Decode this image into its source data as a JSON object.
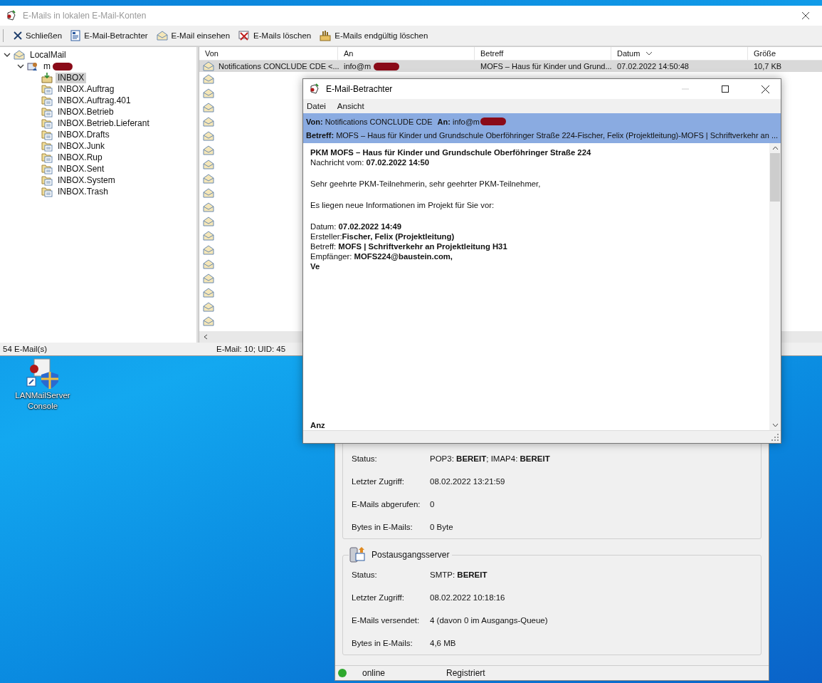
{
  "main_window": {
    "title": "E-Mails in lokalen E-Mail-Konten",
    "active": false,
    "toolbar": [
      {
        "kind": "close",
        "label": "Schließen"
      },
      {
        "kind": "viewer",
        "label": "E-Mail-Betrachter"
      },
      {
        "kind": "envelope",
        "label": "E-Mail einsehen"
      },
      {
        "kind": "delete",
        "label": "E-Mails löschen"
      },
      {
        "kind": "purge",
        "label": "E-Mails endgültig löschen"
      }
    ],
    "tree": [
      {
        "label": "LocalMail",
        "expanded": true,
        "children": [
          {
            "label": "m",
            "expanded": true,
            "redacted": true,
            "children": [
              {
                "label": "INBOX",
                "kind": "inbox",
                "selected": true
              },
              {
                "label": "INBOX.Auftrag",
                "kind": "folder",
                "selected": false
              },
              {
                "label": "INBOX.Auftrag.401",
                "kind": "folder",
                "selected": false
              },
              {
                "label": "INBOX.Betrieb",
                "kind": "folder",
                "selected": false
              },
              {
                "label": "INBOX.Betrieb.Lieferant",
                "kind": "folder",
                "selected": false
              },
              {
                "label": "INBOX.Drafts",
                "kind": "folder",
                "selected": false
              },
              {
                "label": "INBOX.Junk",
                "kind": "folder",
                "selected": false
              },
              {
                "label": "INBOX.Rup",
                "kind": "folder",
                "selected": false
              },
              {
                "label": "INBOX.Sent",
                "kind": "folder",
                "selected": false
              },
              {
                "label": "INBOX.System",
                "kind": "folder",
                "selected": false
              },
              {
                "label": "INBOX.Trash",
                "kind": "folder",
                "selected": false
              }
            ]
          }
        ]
      }
    ],
    "columns": [
      {
        "label": "Von",
        "sorted": false
      },
      {
        "label": "An",
        "sorted": false
      },
      {
        "label": "Betreff",
        "sorted": false
      },
      {
        "label": "Datum",
        "sorted": true
      },
      {
        "label": "Größe",
        "sorted": false
      }
    ],
    "rows": [
      {
        "selected": true,
        "from": "Notifications CONCLUDE CDE <...",
        "to": "info@m",
        "to_redacted": true,
        "subject": "MOFS – Haus für Kinder und Grund...",
        "date": "07.02.2022 14:50:48",
        "size": "10,7 KB"
      },
      {
        "selected": false
      },
      {
        "selected": false
      },
      {
        "selected": false
      },
      {
        "selected": false
      },
      {
        "selected": false
      },
      {
        "selected": false
      },
      {
        "selected": false
      },
      {
        "selected": false
      },
      {
        "selected": false
      },
      {
        "selected": false
      },
      {
        "selected": false
      },
      {
        "selected": false
      },
      {
        "selected": false
      },
      {
        "selected": false
      },
      {
        "selected": false
      },
      {
        "selected": false
      },
      {
        "selected": false
      },
      {
        "selected": false
      }
    ],
    "status_bar": [
      "54 E-Mail(s)",
      "E-Mail: 10; UID: 45"
    ]
  },
  "desktop_icon": {
    "label": "LANMailServer Console"
  },
  "console_window": {
    "groups": [
      {
        "rows": [
          {
            "label": "Status:",
            "value": "POP3: **BEREIT**; IMAP4: **BEREIT**"
          },
          {
            "label": "Letzter Zugriff:",
            "value": "08.02.2022 13:21:59"
          },
          {
            "label": "E-Mails abgerufen:",
            "value": "0"
          },
          {
            "label": "Bytes in E-Mails:",
            "value": "0 Byte"
          }
        ]
      },
      {
        "title": "Postausgangsserver",
        "rows": [
          {
            "label": "Status:",
            "value": "SMTP: **BEREIT**"
          },
          {
            "label": "Letzter Zugriff:",
            "value": "08.02.2022 10:18:16"
          },
          {
            "label": "E-Mails versendet:",
            "value": "4 (davon 0 im Ausgangs-Queue)"
          },
          {
            "label": "Bytes in E-Mails:",
            "value": "4,6 MB"
          }
        ]
      }
    ],
    "status_bar": {
      "online": true,
      "connection": "online",
      "license": "Registriert"
    }
  },
  "viewer_window": {
    "title": "E-Mail-Betrachter",
    "menu": [
      "Datei",
      "Ansicht"
    ],
    "header": {
      "from_label": "Von:",
      "from": "Notifications CONCLUDE CDE",
      "to_label": "An:",
      "to": "info@m",
      "to_redacted": true,
      "subject_label": "Betreff:",
      "subject": "MOFS – Haus für Kinder und Grundschule Oberföhringer Straße 224-Fischer, Felix (Projektleitung)-MOFS | Schriftverkehr an ..."
    },
    "body": [
      {
        "text": "PKM MOFS – Haus für Kinder und Grundschule Oberföhringer Straße 224",
        "bold": true,
        "space_before": false
      },
      {
        "text": "Nachricht vom: **07.02.2022 14:50**",
        "bold": false,
        "space_before": false
      },
      {
        "text": "Sehr geehrte PKM-Teilnehmerin, sehr geehrter PKM-Teilnehmer,",
        "bold": false,
        "space_before": true
      },
      {
        "text": "Es liegen neue Informationen im Projekt für Sie vor:",
        "bold": false,
        "space_before": true
      },
      {
        "text": "Datum: **07.02.2022 14:49**",
        "bold": false,
        "space_before": true
      },
      {
        "text": "Ersteller:**Fischer, Felix (Projektleitung)**",
        "bold": false,
        "space_before": false
      },
      {
        "text": "Betreff: **MOFS | Schriftverkehr an Projektleitung H31**",
        "bold": false,
        "space_before": false
      },
      {
        "text": "Empfänger: **MOFS224@baustein.com,**",
        "bold": false,
        "space_before": false
      },
      {
        "text": "Ve",
        "bold": true,
        "space_before": false
      }
    ],
    "body_bottom": [
      {
        "text": "Anz",
        "bold": true
      }
    ]
  }
}
